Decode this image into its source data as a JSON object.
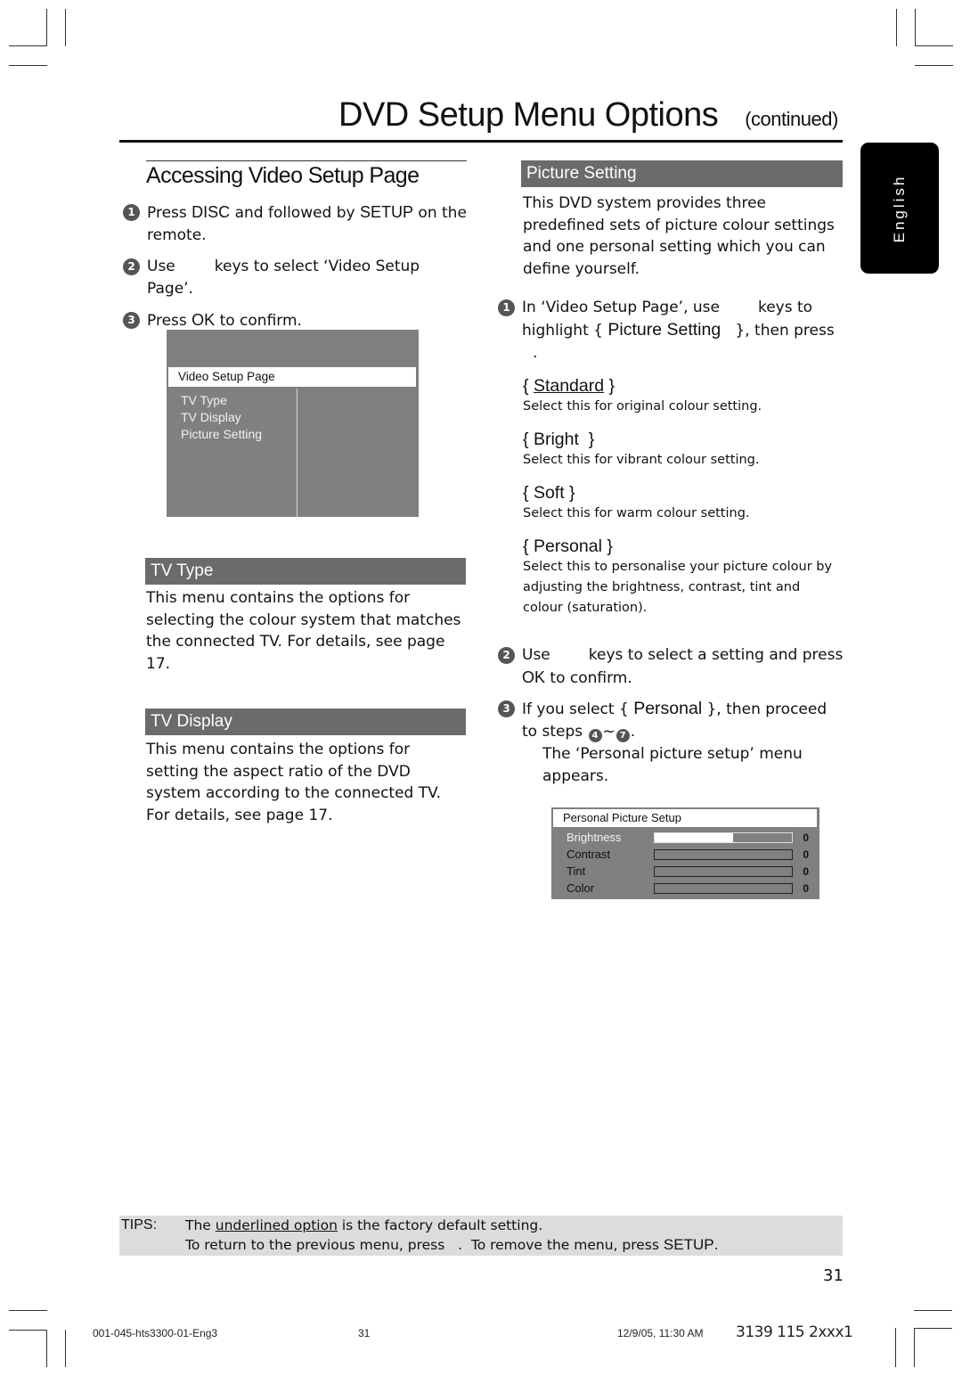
{
  "header": {
    "title": "DVD Setup Menu Options",
    "continued": "(continued)"
  },
  "language_tab": "English",
  "left": {
    "section_title": "Accessing Video Setup Page",
    "steps": [
      {
        "num": "1",
        "pre": "Press ",
        "key1": "DISC",
        "mid": " and followed by ",
        "key2": "SETUP",
        "post": " on the remote."
      },
      {
        "num": "2",
        "pre": "Use",
        "post": "keys to select ‘Video Setup Page’."
      },
      {
        "num": "3",
        "pre": "Press ",
        "key": "OK",
        "post": " to confirm."
      }
    ],
    "osd": {
      "header": "Video Setup Page",
      "items": [
        "TV Type",
        "TV Display",
        "Picture Setting"
      ]
    },
    "tv_type": {
      "heading": "TV Type",
      "body": "This menu contains the options for selecting the colour system that matches the connected TV.  For details, see page 17."
    },
    "tv_display": {
      "heading": "TV Display",
      "body": "This menu contains the options for setting the aspect ratio of the DVD system according to the connected TV. For details, see page 17."
    }
  },
  "right": {
    "heading": "Picture Setting",
    "intro": "This DVD system provides three predefined sets of picture colour settings and one personal setting which you can define yourself.",
    "step1": {
      "num": "1",
      "line1_pre": "In ‘Video Setup Page’, use",
      "line1_post": "keys to",
      "line2_pre": "highlight { ",
      "line2_key": "Picture Setting",
      "line2_post": " }, then press",
      "line3": "."
    },
    "options": [
      {
        "label": "Standard",
        "default": true,
        "desc": "Select this for original colour setting."
      },
      {
        "label": "Bright",
        "default": false,
        "desc": "Select this for vibrant colour setting."
      },
      {
        "label": "Soft",
        "default": false,
        "desc": "Select this for warm colour setting."
      },
      {
        "label": "Personal",
        "default": false,
        "desc": "Select this to personalise your picture colour by adjusting the brightness, contrast, tint and colour (saturation)."
      }
    ],
    "step2": {
      "num": "2",
      "pre": "Use",
      "post": "keys to select a setting and press",
      "key": "OK",
      "tail": " to confirm."
    },
    "step3": {
      "num": "3",
      "pre": "If you select { ",
      "key": "Personal",
      "post": " }, then proceed to steps ",
      "from": "4",
      "tilde": "~",
      "to": "7",
      "end": ".",
      "note": "The ‘Personal picture setup’ menu appears."
    },
    "pps": {
      "header": "Personal Picture Setup",
      "rows": [
        {
          "label": "Brightness",
          "value": "0",
          "fill": 0.57,
          "active": true
        },
        {
          "label": "Contrast",
          "value": "0",
          "fill": 0,
          "active": false
        },
        {
          "label": "Tint",
          "value": "0",
          "fill": 0,
          "active": false
        },
        {
          "label": "Color",
          "value": "0",
          "fill": 0,
          "active": false
        }
      ]
    }
  },
  "tips": {
    "label": "TIPS:",
    "line1_pre": "The ",
    "line1_link": "underlined option",
    "line1_post": " is the factory default setting.",
    "line2_pre": "To return to the previous menu, press   .  To remove the menu, press ",
    "line2_key": "SETUP",
    "line2_post": "."
  },
  "page_number": "31",
  "footer": {
    "file": "001-045-hts3300-01-Eng3",
    "page": "31",
    "date": "12/9/05, 11:30 AM",
    "code": "3139 115 2xxx1"
  }
}
